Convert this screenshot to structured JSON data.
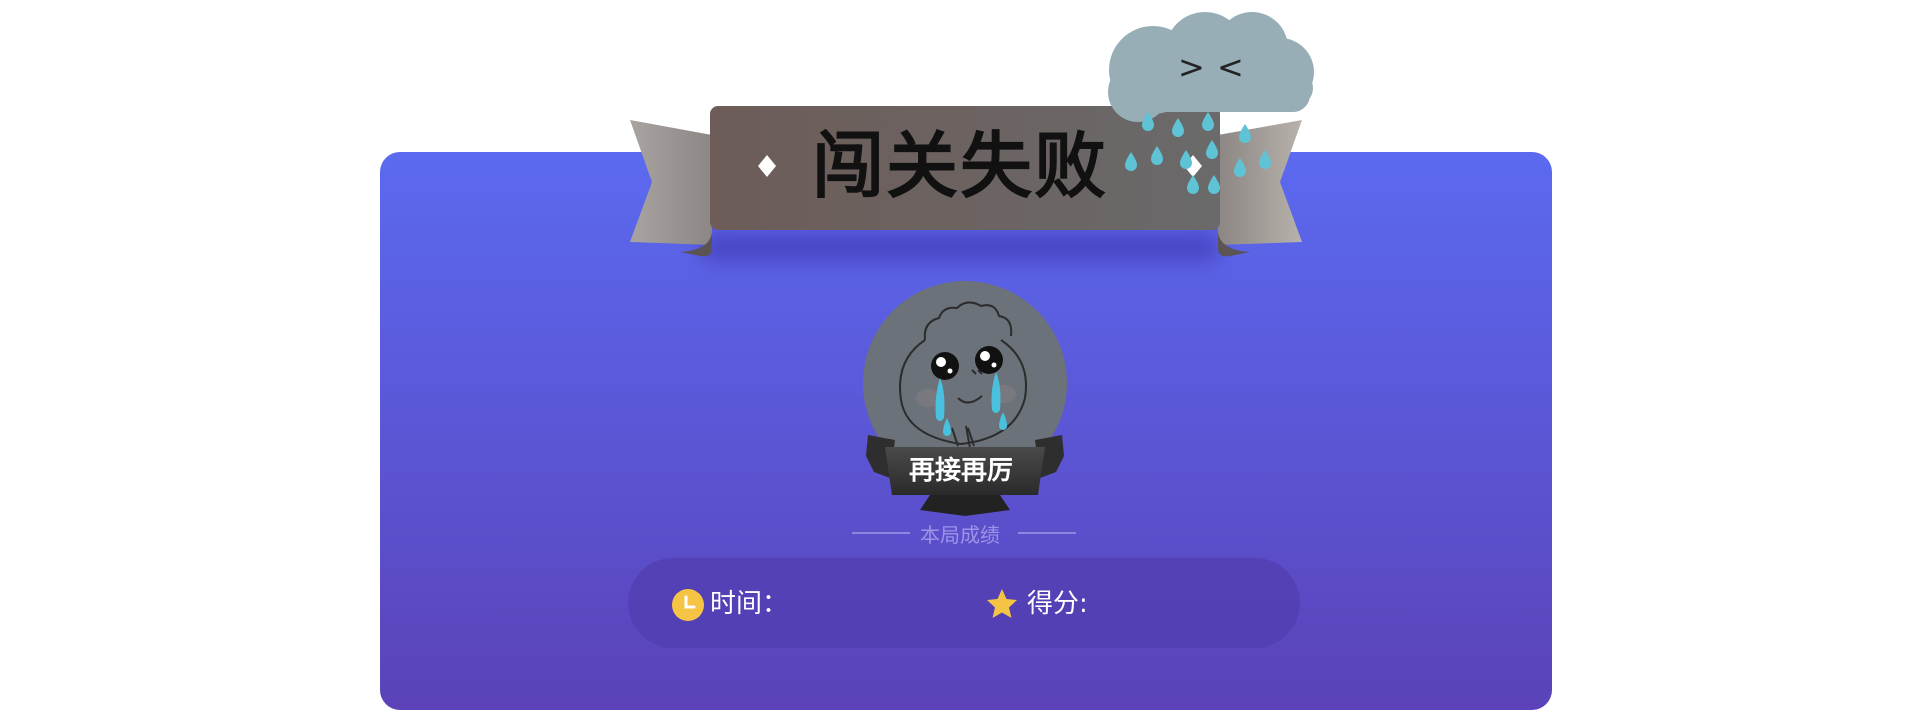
{
  "dialog": {
    "title": "闯关失败",
    "badge_label": "再接再厉",
    "section_label": "本局成绩",
    "cloud_face": "> <",
    "stats": {
      "time_label": "时间：",
      "time_value": "",
      "score_label": "得分:",
      "score_value": ""
    },
    "icons": [
      "clock-icon",
      "star-icon",
      "rain-cloud-icon",
      "crying-character-icon"
    ],
    "colors": {
      "panel_top": "#5b6af0",
      "panel_bottom": "#5b42b8",
      "banner": "#6e5e5a",
      "cloud": "#97aeb7",
      "raindrop": "#5fc3d6",
      "clock": "#f6c445",
      "star": "#f6c445"
    }
  }
}
